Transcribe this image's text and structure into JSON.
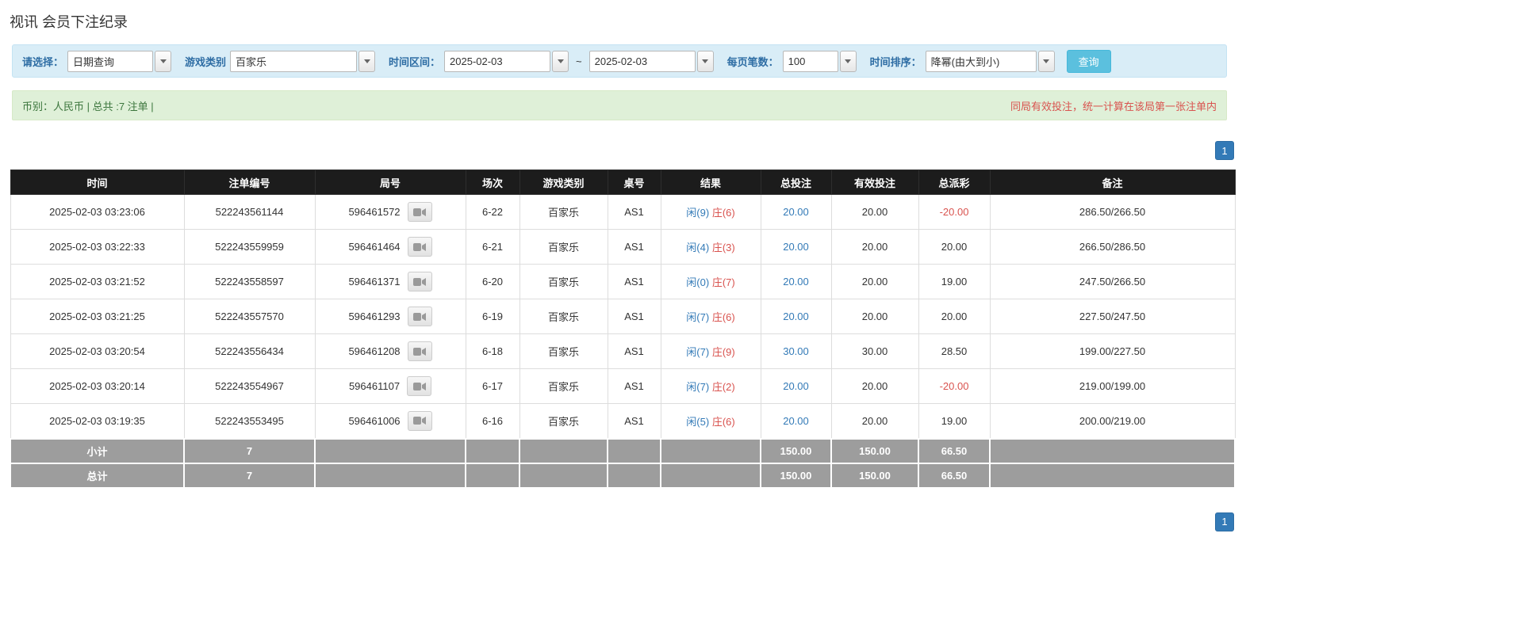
{
  "page": {
    "title": "视讯 会员下注纪录"
  },
  "filters": {
    "select_label": "请选择：",
    "select_value": "日期查询",
    "game_type_label": "游戏类别",
    "game_type_value": "百家乐",
    "time_range_label": "时间区间：",
    "time_from": "2025-02-03",
    "time_separator": "~",
    "time_to": "2025-02-03",
    "per_page_label": "每页笔数：",
    "per_page_value": "100",
    "sort_label": "时间排序：",
    "sort_value": "降幂(由大到小)",
    "search_button": "查询"
  },
  "info_bar": {
    "summary": "币别：人民币 | 总共 :7 注单 |",
    "notice": "同局有效投注，统一计算在该局第一张注单内"
  },
  "pagination": {
    "page": "1"
  },
  "table": {
    "headers": [
      "时间",
      "注单编号",
      "局号",
      "场次",
      "游戏类别",
      "桌号",
      "结果",
      "总投注",
      "有效投注",
      "总派彩",
      "备注"
    ],
    "rows": [
      {
        "time": "2025-02-03 03:23:06",
        "bet_id": "522243561144",
        "round_id": "596461572",
        "session": "6-22",
        "game": "百家乐",
        "table_no": "AS1",
        "result_player": "闲(9)",
        "result_banker": "庄(6)",
        "total_bet": "20.00",
        "valid_bet": "20.00",
        "payout": "-20.00",
        "remark": "286.50/266.50"
      },
      {
        "time": "2025-02-03 03:22:33",
        "bet_id": "522243559959",
        "round_id": "596461464",
        "session": "6-21",
        "game": "百家乐",
        "table_no": "AS1",
        "result_player": "闲(4)",
        "result_banker": "庄(3)",
        "total_bet": "20.00",
        "valid_bet": "20.00",
        "payout": "20.00",
        "remark": "266.50/286.50"
      },
      {
        "time": "2025-02-03 03:21:52",
        "bet_id": "522243558597",
        "round_id": "596461371",
        "session": "6-20",
        "game": "百家乐",
        "table_no": "AS1",
        "result_player": "闲(0)",
        "result_banker": "庄(7)",
        "total_bet": "20.00",
        "valid_bet": "20.00",
        "payout": "19.00",
        "remark": "247.50/266.50"
      },
      {
        "time": "2025-02-03 03:21:25",
        "bet_id": "522243557570",
        "round_id": "596461293",
        "session": "6-19",
        "game": "百家乐",
        "table_no": "AS1",
        "result_player": "闲(7)",
        "result_banker": "庄(6)",
        "total_bet": "20.00",
        "valid_bet": "20.00",
        "payout": "20.00",
        "remark": "227.50/247.50"
      },
      {
        "time": "2025-02-03 03:20:54",
        "bet_id": "522243556434",
        "round_id": "596461208",
        "session": "6-18",
        "game": "百家乐",
        "table_no": "AS1",
        "result_player": "闲(7)",
        "result_banker": "庄(9)",
        "total_bet": "30.00",
        "valid_bet": "30.00",
        "payout": "28.50",
        "remark": "199.00/227.50"
      },
      {
        "time": "2025-02-03 03:20:14",
        "bet_id": "522243554967",
        "round_id": "596461107",
        "session": "6-17",
        "game": "百家乐",
        "table_no": "AS1",
        "result_player": "闲(7)",
        "result_banker": "庄(2)",
        "total_bet": "20.00",
        "valid_bet": "20.00",
        "payout": "-20.00",
        "remark": "219.00/199.00"
      },
      {
        "time": "2025-02-03 03:19:35",
        "bet_id": "522243553495",
        "round_id": "596461006",
        "session": "6-16",
        "game": "百家乐",
        "table_no": "AS1",
        "result_player": "闲(5)",
        "result_banker": "庄(6)",
        "total_bet": "20.00",
        "valid_bet": "20.00",
        "payout": "19.00",
        "remark": "200.00/219.00"
      }
    ],
    "summary_rows": [
      {
        "label": "小计",
        "count": "7",
        "total_bet": "150.00",
        "valid_bet": "150.00",
        "payout": "66.50"
      },
      {
        "label": "总计",
        "count": "7",
        "total_bet": "150.00",
        "valid_bet": "150.00",
        "payout": "66.50"
      }
    ]
  },
  "icons": {
    "dropdown": "chevron-down-icon",
    "round_video": "video-camera-icon"
  },
  "colors": {
    "accent_blue": "#337ab7",
    "negative_red": "#d9534f",
    "player_blue": "#337ab7",
    "banker_red": "#d9534f",
    "search_button_bg": "#5bc0de",
    "table_header_bg": "#1c1c1c",
    "summary_row_bg": "#9d9d9d",
    "filter_bar_bg": "#d9edf7",
    "info_bar_bg": "#dff0d8"
  }
}
